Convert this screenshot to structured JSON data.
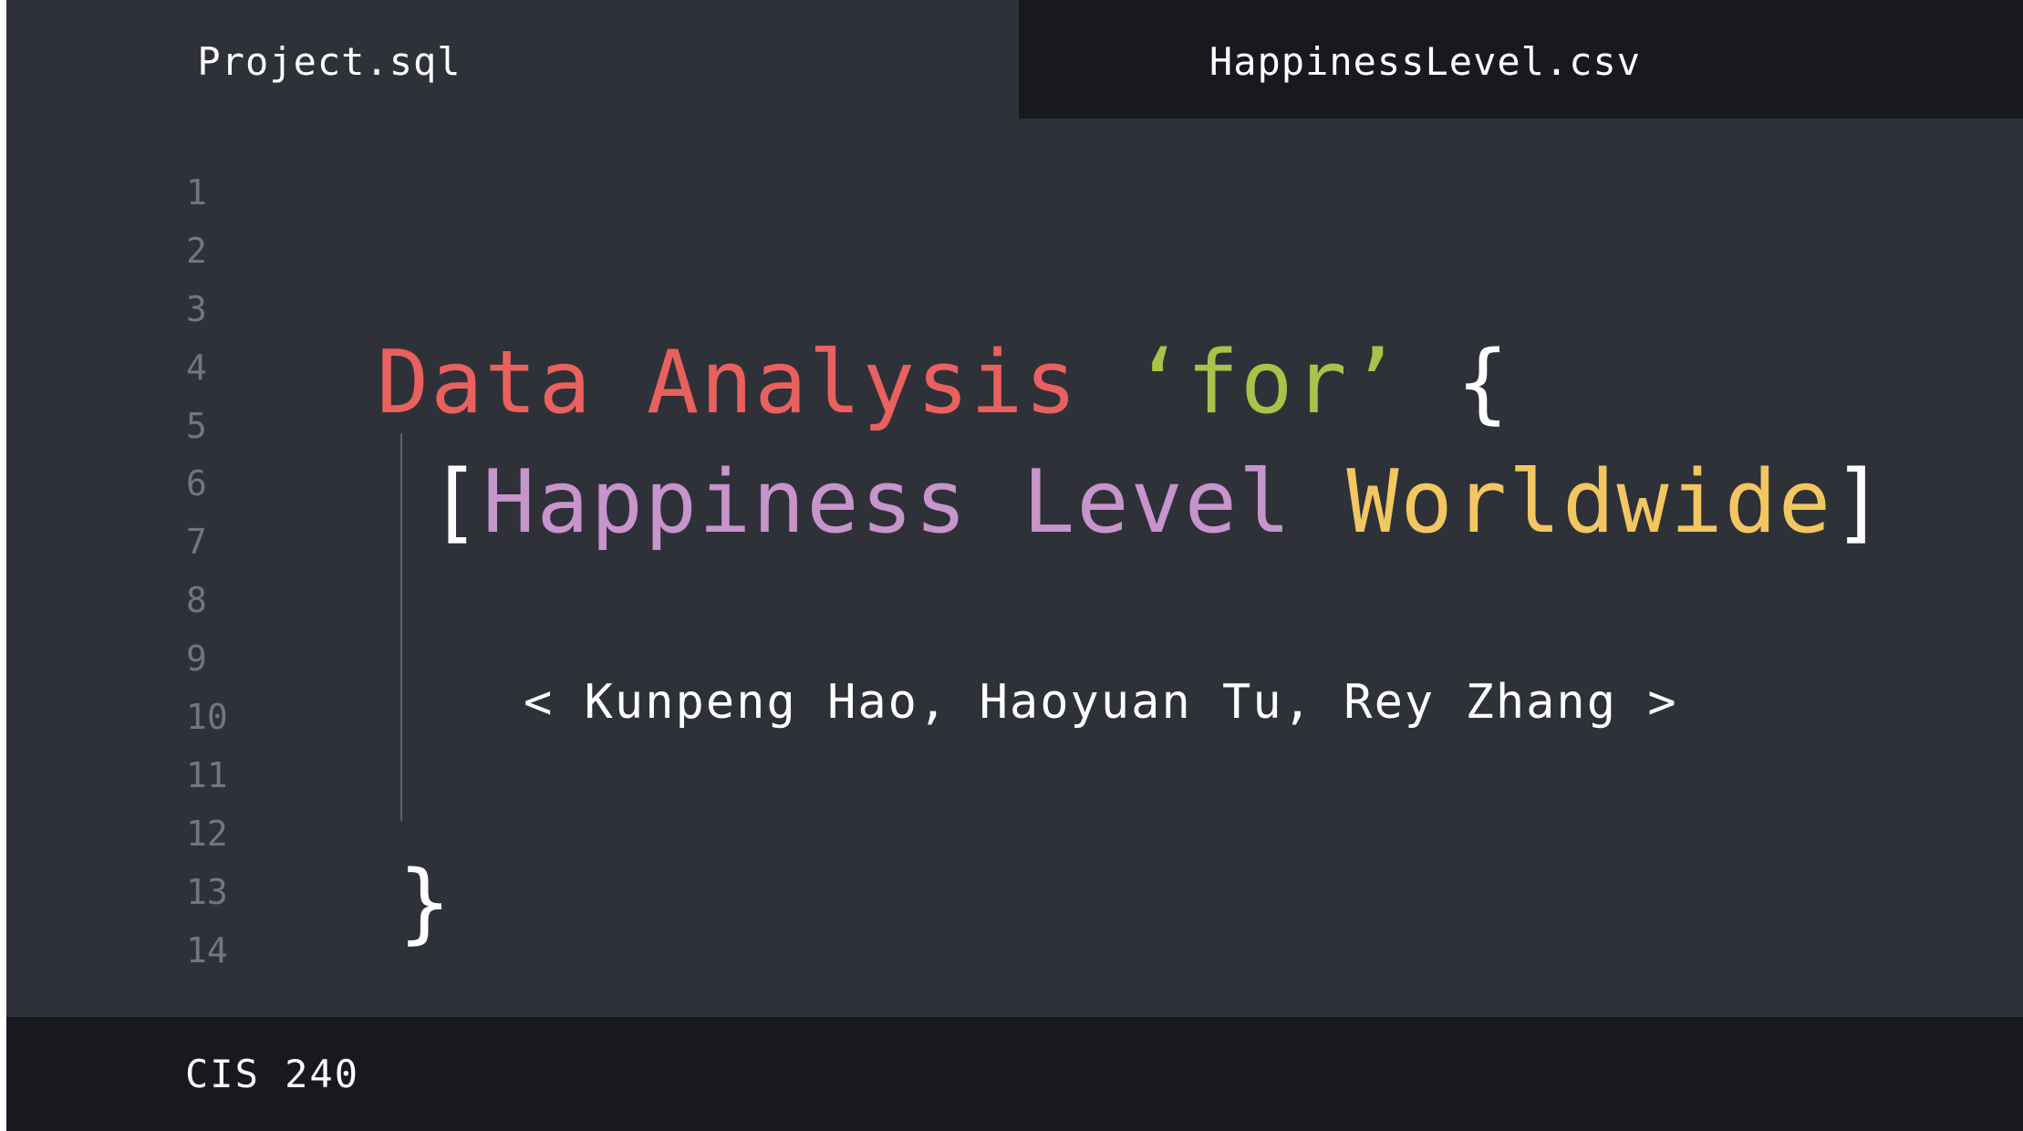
{
  "tabs": [
    {
      "label": "Project.sql",
      "active": true
    },
    {
      "label": "HappinessLevel.csv",
      "active": false
    }
  ],
  "line_numbers": [
    "1",
    "2",
    "3",
    "4",
    "5",
    "6",
    "7",
    "8",
    "9",
    "10",
    "11",
    "12",
    "13",
    "14"
  ],
  "code": {
    "title_part1": "Data Analysis",
    "title_part2": "‘for’",
    "open_brace": "{",
    "open_bracket": "[",
    "subtitle_part1": "Happiness Level",
    "subtitle_part2": "Worldwide",
    "close_bracket": "]",
    "authors": "< Kunpeng Hao, Haoyuan Tu, Rey Zhang >",
    "close_brace": "}"
  },
  "status": {
    "label": "CIS 240"
  },
  "colors": {
    "editor_bg": "#2f3139",
    "bar_bg": "#18191e",
    "keyword_red": "#e8615f",
    "string_green": "#a8c34a",
    "purple": "#c794cc",
    "yellow": "#f2c661",
    "white": "#ffffff",
    "line_number_gray": "#74767d"
  }
}
